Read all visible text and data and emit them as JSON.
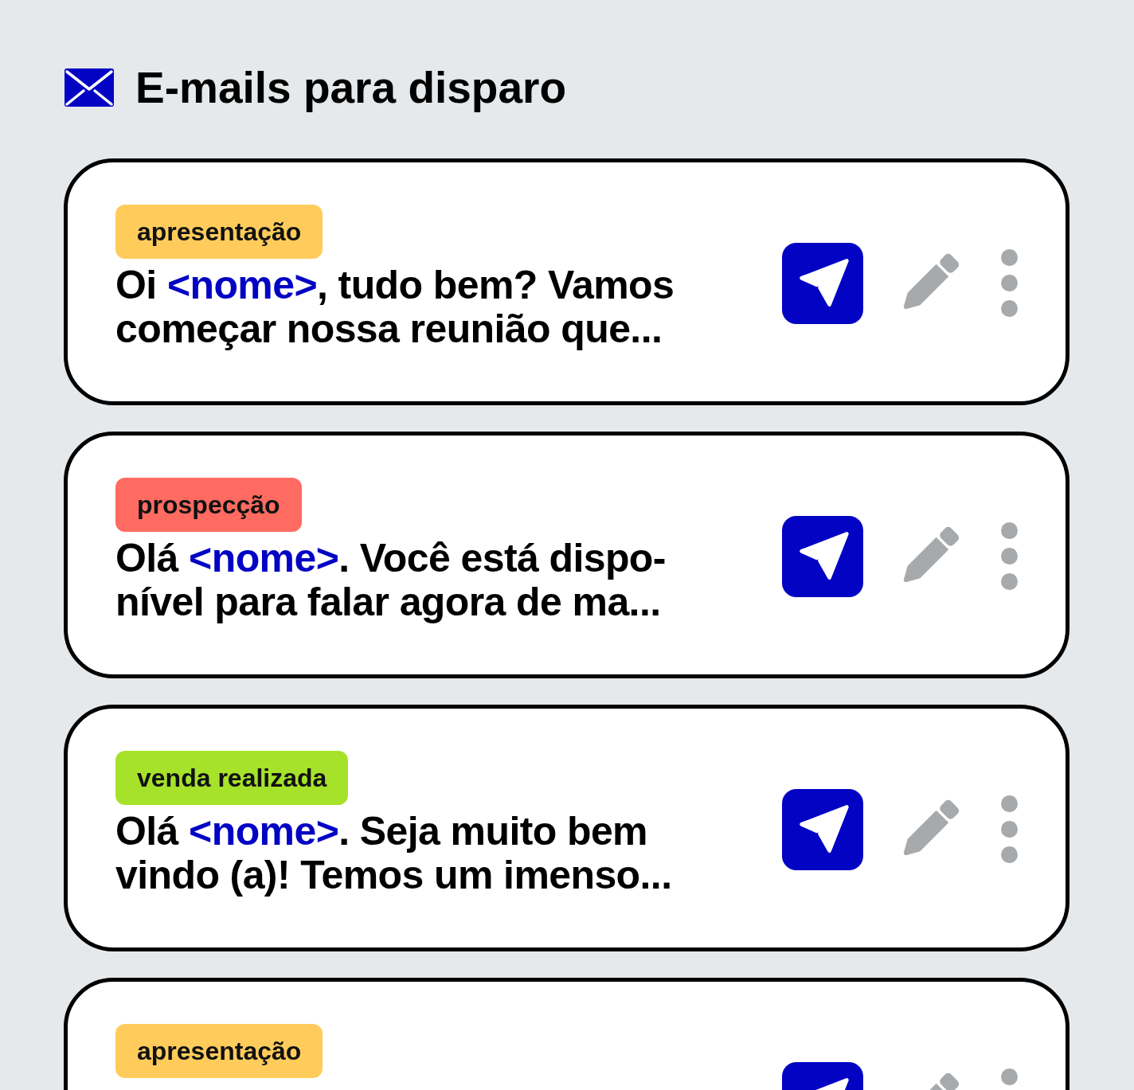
{
  "header": {
    "title": "E-mails para disparo"
  },
  "emails": [
    {
      "tag": {
        "label": "apresentação",
        "color": "#ffcc5c"
      },
      "message": [
        {
          "kind": "text",
          "text": "Oi "
        },
        {
          "kind": "variable",
          "text": "<nome>"
        },
        {
          "kind": "text",
          "text": ", tudo bem? Vamos\ncomeçar nossa reunião que..."
        }
      ]
    },
    {
      "tag": {
        "label": "prospecção",
        "color": "#ff6b61"
      },
      "message": [
        {
          "kind": "text",
          "text": "Olá "
        },
        {
          "kind": "variable",
          "text": "<nome>"
        },
        {
          "kind": "text",
          "text": ". Você está dispo-\nnível para falar agora de ma..."
        }
      ]
    },
    {
      "tag": {
        "label": "venda realizada",
        "color": "#a6e22a"
      },
      "message": [
        {
          "kind": "text",
          "text": "Olá "
        },
        {
          "kind": "variable",
          "text": "<nome>"
        },
        {
          "kind": "text",
          "text": ". Seja muito bem\nvindo (a)! Temos um imenso..."
        }
      ]
    },
    {
      "tag": {
        "label": "apresentação",
        "color": "#ffcc5c"
      }
    }
  ]
}
